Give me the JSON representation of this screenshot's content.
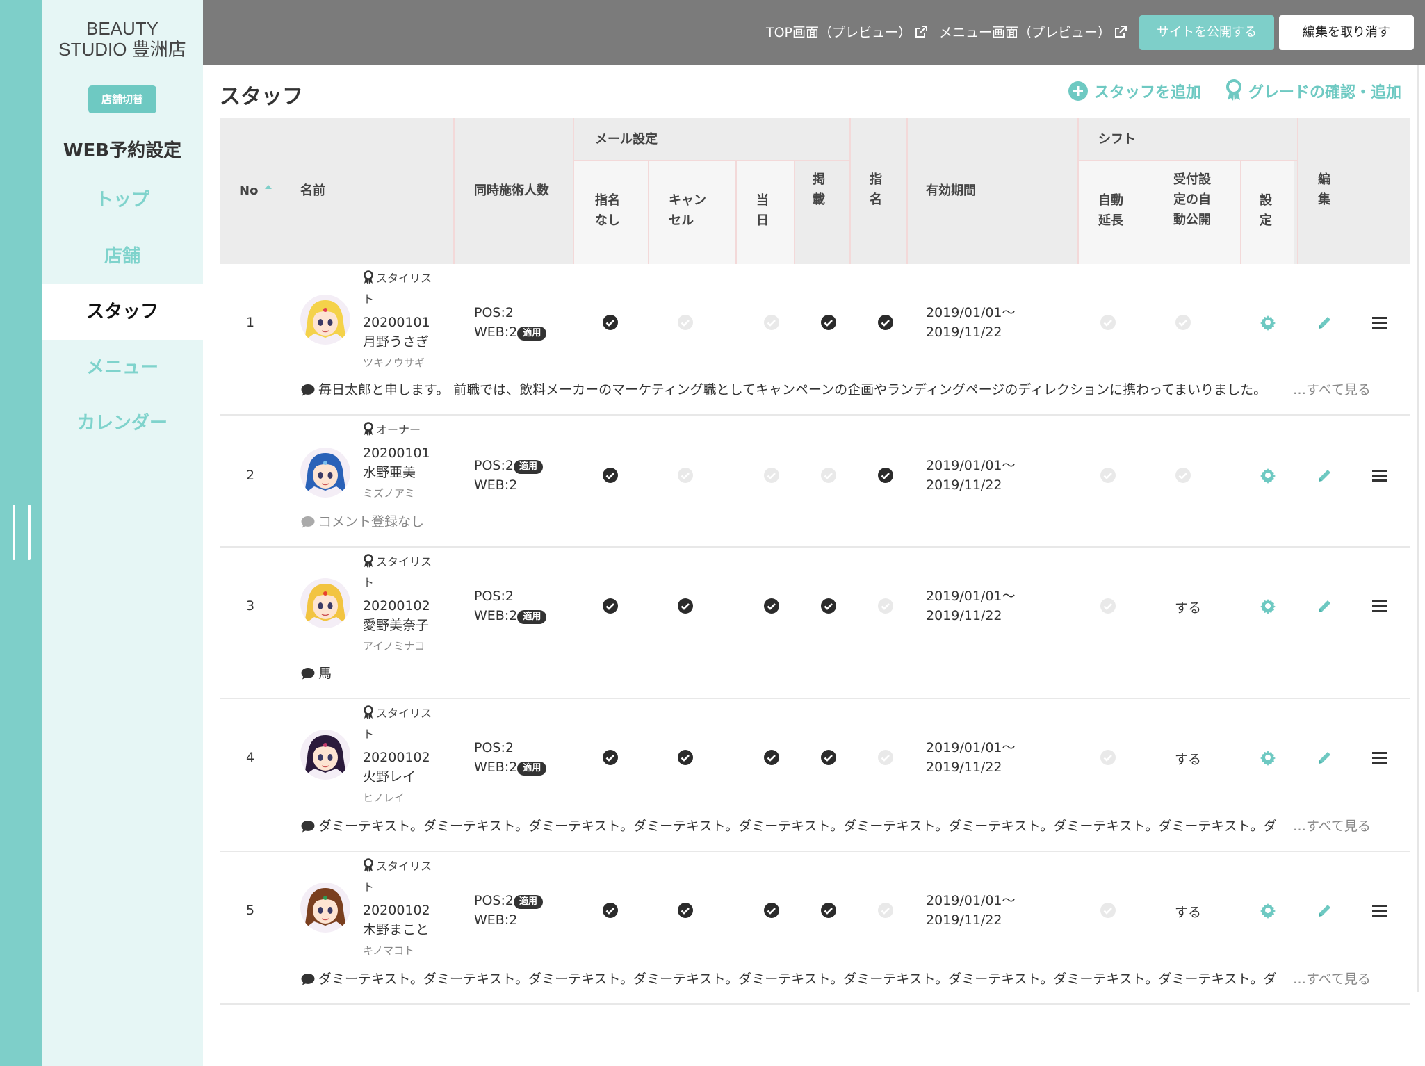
{
  "store": {
    "line1": "BEAUTY",
    "line2": "STUDIO 豊洲店",
    "switch_label": "店舗切替"
  },
  "sidebar": {
    "heading": "WEB予約設定",
    "items": [
      {
        "label": "トップ"
      },
      {
        "label": "店舗"
      },
      {
        "label": "スタッフ"
      },
      {
        "label": "メニュー"
      },
      {
        "label": "カレンダー"
      }
    ],
    "active": "スタッフ"
  },
  "header": {
    "top_preview": "TOP画面（プレビュー）",
    "menu_preview": "メニュー画面（プレビュー）",
    "publish": "サイトを公開する",
    "cancel": "編集を取り消す"
  },
  "page": {
    "title": "スタッフ",
    "add_staff": "スタッフを追加",
    "grade": "グレードの確認・追加"
  },
  "table": {
    "headers": {
      "no": "No",
      "name": "名前",
      "concurrent": "同時施術人数",
      "mail": "メール設定",
      "mail_unassigned": "指名なし",
      "mail_cancel": "キャンセル",
      "mail_sameday": "当日",
      "published": "掲載",
      "nominate": "指名",
      "period": "有効期間",
      "shift": "シフト",
      "auto_extend": "自動延長",
      "auto_publish": "受付設定の自動公開",
      "shift_setting": "設定",
      "edit": "編集"
    },
    "applied_badge": "適用",
    "see_all": "…すべて見る",
    "rows": [
      {
        "no": "1",
        "grade": "スタイリスト",
        "id": "20200101",
        "name": "月野うさぎ",
        "kana": "ツキノウサギ",
        "pos": "POS:2",
        "web": "WEB:2",
        "applied": "web",
        "mail_unassigned": true,
        "mail_cancel": false,
        "mail_sameday": false,
        "published": true,
        "nominate": true,
        "period_start": "2019/01/01〜",
        "period_end": "2019/11/22",
        "auto_extend": false,
        "auto_publish": false,
        "auto_publish_text": "",
        "comment": "毎日太郎と申します。 前職では、飲料メーカーのマーケティング職としてキャンペーンの企画やランディングページのディレクションに携わってまいりました。",
        "has_see_all": true,
        "avatar_hair": "#f4d24a",
        "avatar_accent": "#e23b54"
      },
      {
        "no": "2",
        "grade": "オーナー",
        "id": "20200101",
        "name": "水野亜美",
        "kana": "ミズノアミ",
        "pos": "POS:2",
        "web": "WEB:2",
        "applied": "pos",
        "mail_unassigned": true,
        "mail_cancel": false,
        "mail_sameday": false,
        "published": false,
        "nominate": true,
        "period_start": "2019/01/01〜",
        "period_end": "2019/11/22",
        "auto_extend": false,
        "auto_publish": false,
        "auto_publish_text": "",
        "comment": "コメント登録なし",
        "comment_empty": true,
        "has_see_all": false,
        "avatar_hair": "#2a62b8",
        "avatar_accent": "#7bc0ee"
      },
      {
        "no": "3",
        "grade": "スタイリスト",
        "id": "20200102",
        "name": "愛野美奈子",
        "kana": "アイノミナコ",
        "pos": "POS:2",
        "web": "WEB:2",
        "applied": "web",
        "mail_unassigned": true,
        "mail_cancel": true,
        "mail_sameday": true,
        "published": true,
        "nominate": false,
        "period_start": "2019/01/01〜",
        "period_end": "2019/11/22",
        "auto_extend": false,
        "auto_publish": false,
        "auto_publish_text": "する",
        "comment": "馬",
        "has_see_all": false,
        "avatar_hair": "#f2c441",
        "avatar_accent": "#e8402f"
      },
      {
        "no": "4",
        "grade": "スタイリスト",
        "id": "20200102",
        "name": "火野レイ",
        "kana": "ヒノレイ",
        "pos": "POS:2",
        "web": "WEB:2",
        "applied": "web",
        "mail_unassigned": true,
        "mail_cancel": true,
        "mail_sameday": true,
        "published": true,
        "nominate": false,
        "period_start": "2019/01/01〜",
        "period_end": "2019/11/22",
        "auto_extend": false,
        "auto_publish": false,
        "auto_publish_text": "する",
        "comment": "ダミーテキスト。ダミーテキスト。ダミーテキスト。ダミーテキスト。ダミーテキスト。ダミーテキスト。ダミーテキスト。ダミーテキスト。ダミーテキスト。ダ",
        "has_see_all": true,
        "avatar_hair": "#2b1a3c",
        "avatar_accent": "#c33a6b"
      },
      {
        "no": "5",
        "grade": "スタイリスト",
        "id": "20200102",
        "name": "木野まこと",
        "kana": "キノマコト",
        "pos": "POS:2",
        "web": "WEB:2",
        "applied": "pos",
        "mail_unassigned": true,
        "mail_cancel": true,
        "mail_sameday": true,
        "published": true,
        "nominate": false,
        "period_start": "2019/01/01〜",
        "period_end": "2019/11/22",
        "auto_extend": false,
        "auto_publish": false,
        "auto_publish_text": "する",
        "comment": "ダミーテキスト。ダミーテキスト。ダミーテキスト。ダミーテキスト。ダミーテキスト。ダミーテキスト。ダミーテキスト。ダミーテキスト。ダミーテキスト。ダ",
        "has_see_all": true,
        "avatar_hair": "#7a3f1f",
        "avatar_accent": "#2f9b54"
      }
    ]
  },
  "colors": {
    "accent": "#7ecfc9",
    "rail": "#7ecfc9",
    "header": "#7b7b7b",
    "sidebar": "#e6f6f5"
  },
  "icons": [
    "external-link-icon",
    "plus-circle-icon",
    "award-icon",
    "check-circle-icon",
    "gear-icon",
    "pencil-icon",
    "hamburger-icon",
    "speech-bubble-icon"
  ]
}
